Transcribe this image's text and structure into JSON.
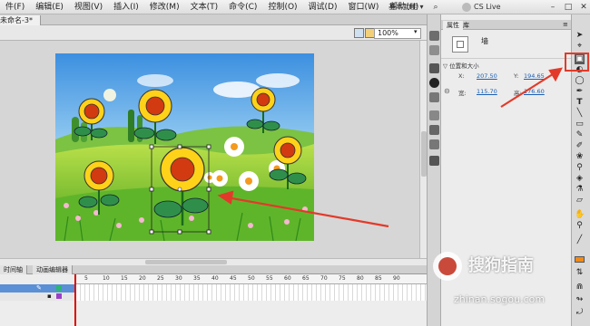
{
  "menu": {
    "items": [
      "件(F)",
      "编辑(E)",
      "视图(V)",
      "插入(I)",
      "修改(M)",
      "文本(T)",
      "命令(C)",
      "控制(O)",
      "调试(D)",
      "窗口(W)",
      "帮助(H)"
    ],
    "workspace": "基本功能",
    "cs_live": "CS Live"
  },
  "document": {
    "tab_title": "未命名-3*",
    "zoom": "100%"
  },
  "properties": {
    "tabs": [
      "属性",
      "库"
    ],
    "symbol_name": "墙",
    "section_title": "位置和大小",
    "x_label": "X:",
    "x_value": "207.50",
    "y_label": "Y:",
    "y_value": "194.65",
    "w_label": "宽:",
    "w_value": "115.70",
    "h_label": "高:",
    "h_value": "176.60"
  },
  "timeline": {
    "tabs": [
      "时间轴",
      "动画编辑器"
    ],
    "ticks": [
      "5",
      "10",
      "15",
      "20",
      "25",
      "30",
      "35",
      "40",
      "45",
      "50",
      "55",
      "60",
      "65",
      "70",
      "75",
      "80",
      "85",
      "90"
    ]
  },
  "watermark": {
    "brand": "搜狗指南",
    "url": "zhinan.sogou.com"
  },
  "colors": {
    "highlight": "#e23a2a",
    "link": "#1a5fb4"
  }
}
